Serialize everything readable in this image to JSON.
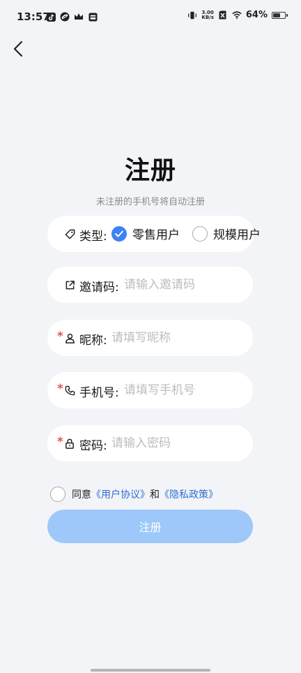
{
  "status_bar": {
    "time": "13:57",
    "net_speed_value": "3.00",
    "net_speed_unit": "KB/s",
    "battery_percent": "64%",
    "battery_level": 0.64,
    "left_icons": [
      "tiktok-icon",
      "app-icon",
      "crown-icon",
      "wallet-icon"
    ],
    "right_icons": [
      "vibrate-icon",
      "no-sim-icon",
      "wifi-icon",
      "battery-icon"
    ]
  },
  "header": {
    "back_icon": "chevron-left-icon",
    "title": "注册",
    "subtitle": "未注册的手机号将自动注册"
  },
  "form": {
    "type": {
      "icon": "tag-icon",
      "label": "类型:",
      "options": [
        {
          "label": "零售用户",
          "selected": true
        },
        {
          "label": "规模用户",
          "selected": false
        }
      ]
    },
    "invite": {
      "icon": "external-link-icon",
      "label": "邀请码:",
      "placeholder": "请输入邀请码",
      "value": ""
    },
    "nickname": {
      "required_mark": "*",
      "icon": "user-icon",
      "label": "昵称:",
      "placeholder": "请填写昵称",
      "value": ""
    },
    "phone": {
      "required_mark": "*",
      "icon": "phone-icon",
      "label": "手机号:",
      "placeholder": "请填写手机号",
      "value": ""
    },
    "password": {
      "required_mark": "*",
      "icon": "lock-icon",
      "label": "密码:",
      "placeholder": "请输入密码",
      "value": ""
    }
  },
  "agreement": {
    "checked": false,
    "prefix": "同意",
    "user_agreement": "《用户协议》",
    "conjunction": "和",
    "privacy_policy": "《隐私政策》"
  },
  "submit": {
    "label": "注册"
  },
  "colors": {
    "accent": "#3b82f6",
    "link": "#2f6fd1",
    "button_disabled": "#9dc8f9",
    "required": "#e05555",
    "background": "#f3f4f8"
  }
}
